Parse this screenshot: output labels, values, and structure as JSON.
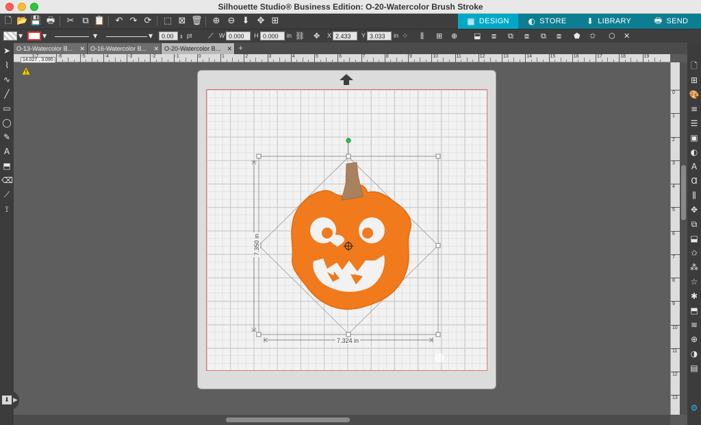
{
  "window": {
    "title": "Silhouette Studio® Business Edition: O-20-Watercolor Brush Stroke"
  },
  "nav_tabs": [
    {
      "label": "DESIGN",
      "icon": "grid-icon"
    },
    {
      "label": "STORE",
      "icon": "store-icon"
    },
    {
      "label": "LIBRARY",
      "icon": "library-icon"
    },
    {
      "label": "SEND",
      "icon": "send-icon"
    }
  ],
  "toolbar2": {
    "line_width_value": "0.00",
    "line_width_unit": "pt",
    "w_label": "W",
    "w_value": "0.000",
    "h_label": "H",
    "h_value": "0.000",
    "size_unit": "in",
    "x_label": "X",
    "x_value": "2.433",
    "y_label": "Y",
    "y_value": "3.033"
  },
  "doc_tabs": [
    {
      "label": "O-13-Watercolor B...",
      "active": false
    },
    {
      "label": "O-16-Watercolor B...",
      "active": false
    },
    {
      "label": "O-20-Watercolor B...",
      "active": true
    }
  ],
  "ruler": {
    "coords": "14.027 , 3.095",
    "h_ticks": [
      "-7",
      "-6",
      "-5",
      "-4",
      "-3",
      "-2",
      "-1",
      "0",
      "1",
      "2",
      "3",
      "4",
      "5",
      "6",
      "7",
      "8",
      "9",
      "10",
      "11",
      "12",
      "13",
      "14",
      "15",
      "16",
      "17",
      "18",
      "19"
    ],
    "v_ticks": [
      "0",
      "1",
      "2",
      "3",
      "4",
      "5",
      "6",
      "7",
      "8",
      "9",
      "10",
      "11",
      "12",
      "13"
    ]
  },
  "selection": {
    "width_label": "7.324 in",
    "height_label": "7.350 in"
  },
  "colors": {
    "accent": "#00a8c6",
    "nav_inactive": "#0d7d92",
    "pumpkin": "#f07a1c",
    "stem": "#a8825f",
    "mat_border": "#e07070"
  }
}
